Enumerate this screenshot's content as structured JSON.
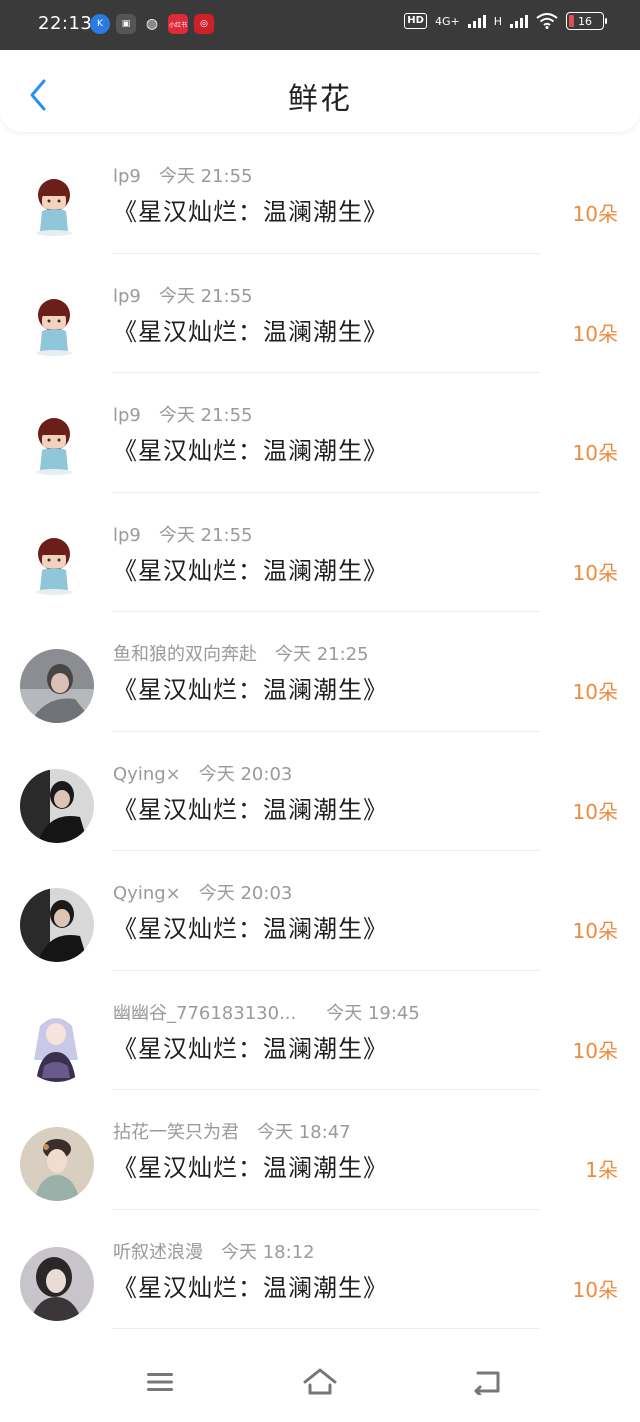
{
  "status_bar": {
    "time": "22:13",
    "apps": [
      {
        "icon": "k-app-icon",
        "color": "#2a7be4",
        "label": "K"
      },
      {
        "icon": "map-app-icon",
        "color": "#555555",
        "label": "▣"
      },
      {
        "icon": "wechat-icon",
        "color": "#3a3a3a",
        "label": "◍"
      },
      {
        "icon": "red-app-icon",
        "color": "#e02a3a",
        "label": "小红书"
      },
      {
        "icon": "bank-app-icon",
        "color": "#d0202a",
        "label": "◎"
      }
    ],
    "hd": "HD",
    "network_1": "4G+",
    "network_2": "H",
    "battery": "16",
    "battery_color": "#e05050"
  },
  "header": {
    "title": "鲜花",
    "accent": "#2a8ff0"
  },
  "items": [
    {
      "user": "lp9",
      "time": "今天 21:55",
      "book": "《星汉灿烂：温澜潮生》",
      "count": "10朵",
      "avatar": "chibi"
    },
    {
      "user": "lp9",
      "time": "今天 21:55",
      "book": "《星汉灿烂：温澜潮生》",
      "count": "10朵",
      "avatar": "chibi"
    },
    {
      "user": "lp9",
      "time": "今天 21:55",
      "book": "《星汉灿烂：温澜潮生》",
      "count": "10朵",
      "avatar": "chibi"
    },
    {
      "user": "lp9",
      "time": "今天 21:55",
      "book": "《星汉灿烂：温澜潮生》",
      "count": "10朵",
      "avatar": "chibi"
    },
    {
      "user": "鱼和狼的双向奔赴",
      "time": "今天 21:25",
      "book": "《星汉灿烂：温澜潮生》",
      "count": "10朵",
      "avatar": "grey-photo"
    },
    {
      "user": "Qying×",
      "time": "今天 20:03",
      "book": "《星汉灿烂：温澜潮生》",
      "count": "10朵",
      "avatar": "dark-photo"
    },
    {
      "user": "Qying×",
      "time": "今天 20:03",
      "book": "《星汉灿烂：温澜潮生》",
      "count": "10朵",
      "avatar": "dark-photo"
    },
    {
      "user": "幽幽谷_776183130...",
      "time": "今天 19:45",
      "book": "《星汉灿烂：温澜潮生》",
      "count": "10朵",
      "avatar": "anime-girl"
    },
    {
      "user": "拈花一笑只为君",
      "time": "今天 18:47",
      "book": "《星汉灿烂：温澜潮生》",
      "count": "1朵",
      "avatar": "painting"
    },
    {
      "user": "听叙述浪漫",
      "time": "今天 18:12",
      "book": "《星汉灿烂：温澜潮生》",
      "count": "10朵",
      "avatar": "portrait"
    }
  ],
  "colors": {
    "count": "#f08a3c",
    "meta": "#9a9a9a",
    "book": "#1f1f1f"
  },
  "nav": {
    "menu_icon": "menu-icon",
    "home_icon": "home-icon",
    "back_icon": "back-nav-icon"
  }
}
